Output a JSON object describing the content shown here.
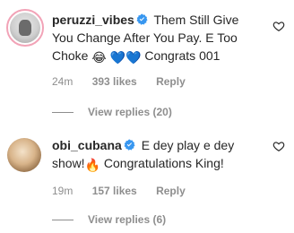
{
  "comments": [
    {
      "username": "peruzzi_vibes",
      "text_part1": "Them Still Give You Change After You Pay. E Too Choke",
      "text_part2": "Congrats 001",
      "time": "24m",
      "likes": "393 likes",
      "reply": "Reply",
      "view_replies": "View replies (20)"
    },
    {
      "username": "obi_cubana",
      "text_part1": "E dey play e dey show!",
      "text_part2": "Congratulations King!",
      "time": "19m",
      "likes": "157 likes",
      "reply": "Reply",
      "view_replies": "View replies (6)"
    }
  ],
  "icons": {
    "verified": "verified-badge-icon",
    "heart": "heart-outline-icon",
    "emoji_laugh": "face-with-tears-of-joy",
    "emoji_heart": "blue-heart",
    "emoji_fire": "fire"
  },
  "colors": {
    "verified_blue": "#3897f0",
    "muted_text": "#8e8e8e",
    "heart_blue": "#1877f2"
  }
}
